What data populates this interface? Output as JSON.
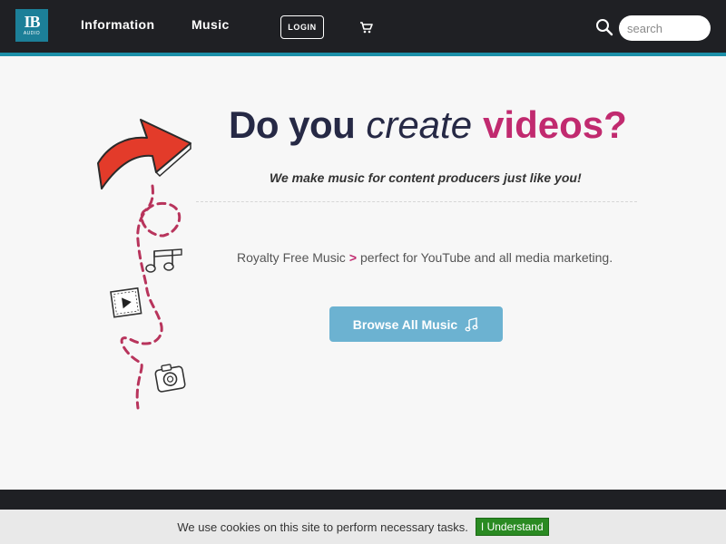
{
  "header": {
    "logo": {
      "mark": "IB",
      "sub": "AUDIO"
    },
    "nav": {
      "information": "Information",
      "music": "Music"
    },
    "login_label": "LOGIN",
    "search": {
      "placeholder": "search"
    }
  },
  "hero": {
    "headline": {
      "part1": "Do you",
      "part2": "create",
      "part3": "videos?"
    },
    "subhead": "We make music for content producers just like you!",
    "tagline": {
      "part1": "Royalty Free Music",
      "chevron": ">",
      "part2": "perfect for YouTube and all media marketing."
    },
    "browse_label": "Browse All Music"
  },
  "cookie": {
    "text": "We use cookies on this site to perform necessary tasks.",
    "button": "I Understand"
  },
  "colors": {
    "header_bg": "#1f2024",
    "accent_line": "#1c8fa8",
    "headline_dark": "#262945",
    "headline_pink": "#c12a6f",
    "button_blue": "#6cb2d1",
    "cookie_green": "#2a8a22"
  }
}
